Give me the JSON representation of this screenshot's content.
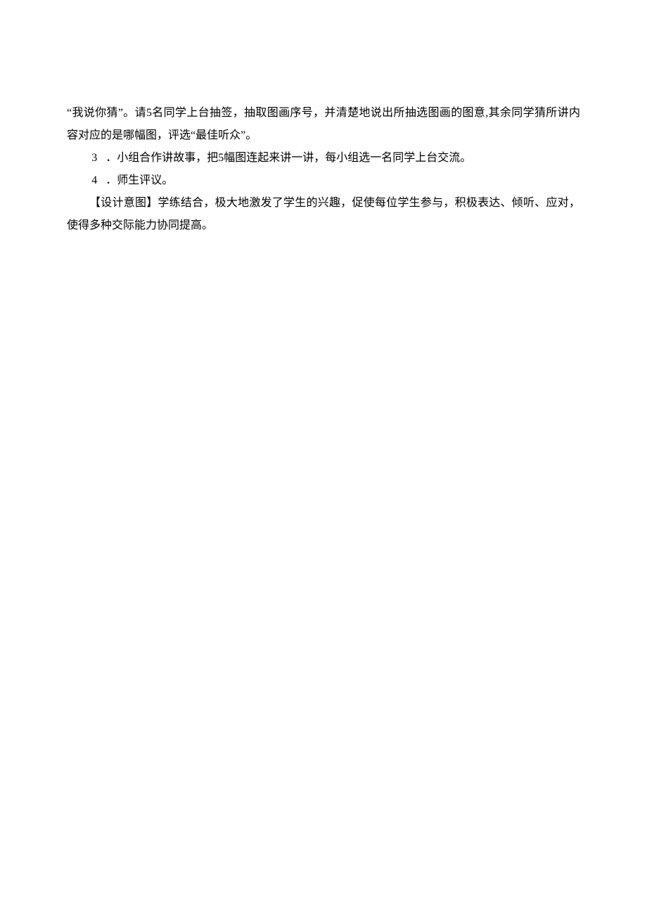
{
  "paragraphs": {
    "p1": "“我说你猜”。请5名同学上台抽签，抽取图画序号，并清楚地说出所抽选图画的图意,其余同学猜所讲内容对应的是哪幅图，评选“最佳听众”。",
    "p2_num": "3",
    "p2_text": "．小组合作讲故事，把5幅图连起来讲一讲，每小组选一名同学上台交流。",
    "p3_num": "4",
    "p3_text": "．师生评议。",
    "p4": "【设计意图】学练结合，极大地激发了学生的兴趣，促使每位学生参与，积极表达、倾听、应对，使得多种交际能力协同提高。"
  }
}
